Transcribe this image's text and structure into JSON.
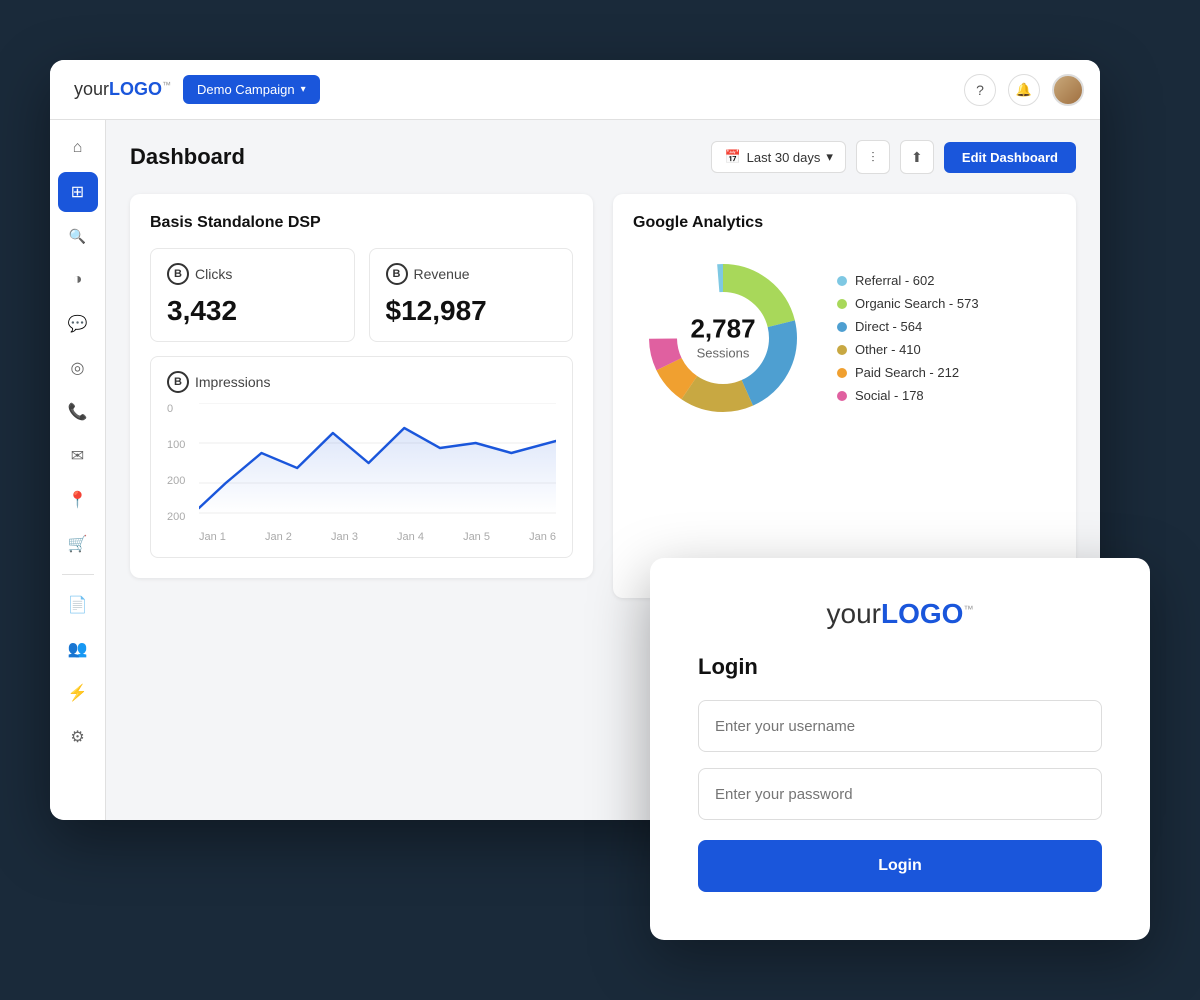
{
  "app": {
    "logo_prefix": "your",
    "logo_main": "LOGO",
    "logo_sup": "™"
  },
  "topnav": {
    "campaign_label": "Demo Campaign",
    "help_icon": "?",
    "notification_icon": "🔔"
  },
  "sidebar": {
    "items": [
      {
        "id": "home",
        "icon": "⌂",
        "active": false
      },
      {
        "id": "dashboard",
        "icon": "⊞",
        "active": true
      },
      {
        "id": "search",
        "icon": "🔍",
        "active": false
      },
      {
        "id": "chart",
        "icon": "◑",
        "active": false
      },
      {
        "id": "comments",
        "icon": "💬",
        "active": false
      },
      {
        "id": "targeting",
        "icon": "◎",
        "active": false
      },
      {
        "id": "phone",
        "icon": "📞",
        "active": false
      },
      {
        "id": "email",
        "icon": "✉",
        "active": false
      },
      {
        "id": "location",
        "icon": "📍",
        "active": false
      },
      {
        "id": "cart",
        "icon": "🛒",
        "active": false
      },
      {
        "id": "document",
        "icon": "📄",
        "active": false
      },
      {
        "id": "users",
        "icon": "👥",
        "active": false
      },
      {
        "id": "plugin",
        "icon": "⚡",
        "active": false
      },
      {
        "id": "settings",
        "icon": "⚙",
        "active": false
      }
    ]
  },
  "dashboard": {
    "title": "Dashboard",
    "date_range": "Last 30 days",
    "edit_button": "Edit Dashboard"
  },
  "dsp_card": {
    "title": "Basis Standalone DSP",
    "metrics": [
      {
        "label": "Clicks",
        "value": "3,432"
      },
      {
        "label": "Revenue",
        "value": "$12,987"
      }
    ],
    "impressions": {
      "label": "Impressions",
      "y_labels": [
        "200",
        "200",
        "100",
        "0"
      ],
      "x_labels": [
        "Jan 1",
        "Jan 2",
        "Jan 3",
        "Jan 4",
        "Jan 5",
        "Jan 6"
      ]
    }
  },
  "analytics_card": {
    "title": "Google Analytics",
    "donut": {
      "total": "2,787",
      "label": "Sessions"
    },
    "legend": [
      {
        "label": "Referral - 602",
        "color": "#7ec8e3"
      },
      {
        "label": "Organic Search - 573",
        "color": "#a8d85a"
      },
      {
        "label": "Direct - 564",
        "color": "#4e9fd1"
      },
      {
        "label": "Other - 410",
        "color": "#c8a842"
      },
      {
        "label": "Paid Search - 212",
        "color": "#f0a030"
      },
      {
        "label": "Social - 178",
        "color": "#e060a0"
      }
    ],
    "segments": [
      {
        "label": "Referral",
        "value": 602,
        "color": "#7ec8e3"
      },
      {
        "label": "Organic Search",
        "value": 573,
        "color": "#a8d85a"
      },
      {
        "label": "Direct",
        "value": 564,
        "color": "#4e9fd1"
      },
      {
        "label": "Other",
        "value": 410,
        "color": "#c8a842"
      },
      {
        "label": "Paid Search",
        "value": 212,
        "color": "#f0a030"
      },
      {
        "label": "Social",
        "value": 178,
        "color": "#e060a0"
      }
    ]
  },
  "login": {
    "logo_prefix": "your",
    "logo_main": "LOGO",
    "logo_sup": "™",
    "title": "Login",
    "username_placeholder": "Enter your username",
    "password_placeholder": "Enter your password",
    "button_label": "Login"
  }
}
